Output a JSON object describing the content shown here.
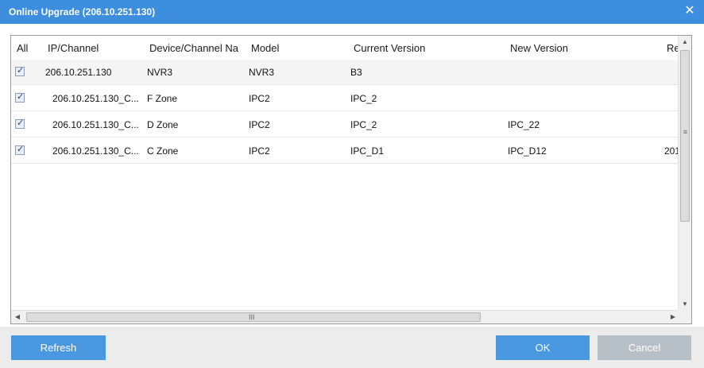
{
  "dialog": {
    "title": "Online Upgrade (206.10.251.130)",
    "close_glyph": "✕"
  },
  "table": {
    "headers": {
      "all": "All",
      "ip": "IP/Channel",
      "name": "Device/Channel Na",
      "model": "Model",
      "current": "Current Version",
      "new": "New Version",
      "rel": "Re"
    },
    "rows": [
      {
        "checked": true,
        "ip": "206.10.251.130",
        "name": "NVR3",
        "model": "NVR3",
        "current": "B3",
        "new": "",
        "rel": ""
      },
      {
        "checked": true,
        "ip": "206.10.251.130_C...",
        "name": "F Zone",
        "model": "IPC2",
        "current": "IPC_2",
        "new": "",
        "rel": ""
      },
      {
        "checked": true,
        "ip": "206.10.251.130_C...",
        "name": "D Zone",
        "model": "IPC2",
        "current": "IPC_2",
        "new": "IPC_22",
        "rel": ""
      },
      {
        "checked": true,
        "ip": "206.10.251.130_C...",
        "name": "C Zone",
        "model": "IPC2",
        "current": "IPC_D1",
        "new": "IPC_D12",
        "rel": "201"
      }
    ],
    "checkbox_glyph": "✓"
  },
  "scroll": {
    "up_arrow": "▲",
    "down_arrow": "▼",
    "left_arrow": "◀",
    "right_arrow": "▶",
    "v_grip": "≡",
    "h_grip": "III"
  },
  "footer": {
    "refresh_label": "Refresh",
    "ok_label": "OK",
    "cancel_label": "Cancel"
  },
  "colors": {
    "titlebar": "#3d8ede",
    "primary_button": "#4a98e0",
    "disabled_button": "#b7bfc7"
  }
}
